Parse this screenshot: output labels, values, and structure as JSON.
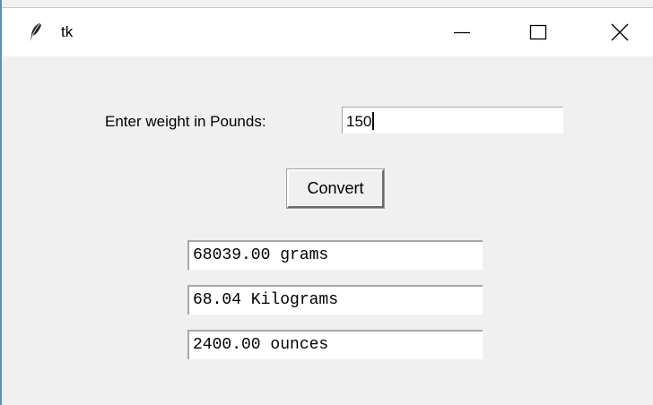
{
  "window": {
    "title": "tk",
    "icons": {
      "app": "feather-icon",
      "minimize": "minimize-icon",
      "maximize": "maximize-icon",
      "close": "close-icon"
    }
  },
  "form": {
    "weight_label": "Enter weight in Pounds:",
    "weight_value": "150",
    "convert_label": "Convert"
  },
  "results": {
    "grams": "68039.00 grams",
    "kilograms": "68.04 Kilograms",
    "ounces": "2400.00 ounces"
  },
  "colors": {
    "background": "#f0f0f0",
    "titlebar": "#ffffff",
    "window_border": "#5b8fc7"
  }
}
